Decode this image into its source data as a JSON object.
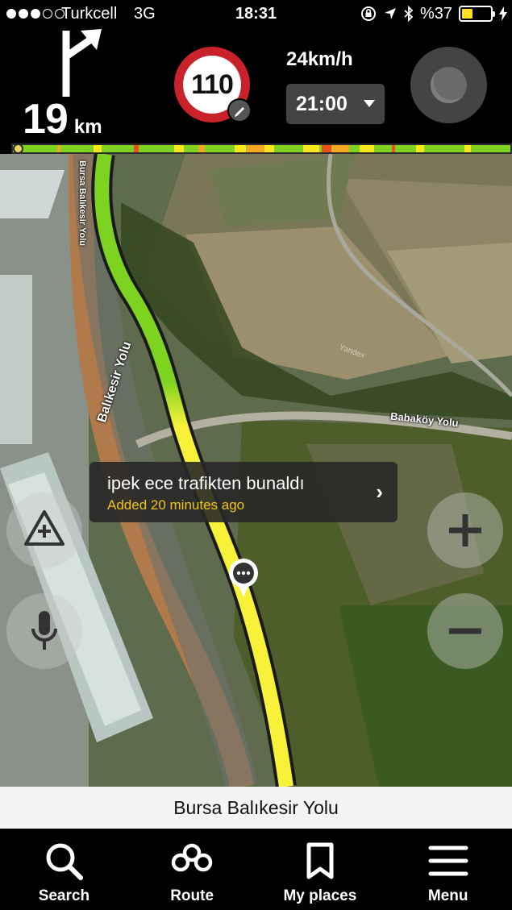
{
  "status_bar": {
    "carrier": "Turkcell",
    "network": "3G",
    "time": "18:31",
    "battery": "%37",
    "battery_level": 0.37,
    "icons": [
      "orientation-lock-icon",
      "location-arrow-icon",
      "bluetooth-icon",
      "charging-icon"
    ]
  },
  "navigation": {
    "next_distance": "19",
    "distance_unit": "km",
    "maneuver_icon": "keep-right-arrow-icon",
    "speed_limit": "110",
    "current_speed": "24km/h",
    "arrival_time": "21:00"
  },
  "traffic_bar": {
    "progress": 0.0,
    "colors": {
      "free": "#7ed321",
      "moderate": "#f8e71c",
      "heavy": "#f5a623",
      "jam": "#e94e1b"
    }
  },
  "map": {
    "street_labels": {
      "bursa_balikesir_small": "Bursa Balıkesir Yolu",
      "babakoy": "Babaköy Yolu",
      "balikesir_main": "Balıkesir Yolu"
    },
    "watermark": "Yandex",
    "route_colors": {
      "green": "#7ed321",
      "yellow": "#f8f13a"
    }
  },
  "event_popup": {
    "title": "ipek ece trafikten bunaldı",
    "subtitle": "Added 20 minutes ago"
  },
  "current_street": "Bursa Balıkesir Yolu",
  "tabs": [
    {
      "label": "Search",
      "icon": "search-icon"
    },
    {
      "label": "Route",
      "icon": "route-icon"
    },
    {
      "label": "My places",
      "icon": "bookmark-icon"
    },
    {
      "label": "Menu",
      "icon": "menu-icon"
    }
  ]
}
